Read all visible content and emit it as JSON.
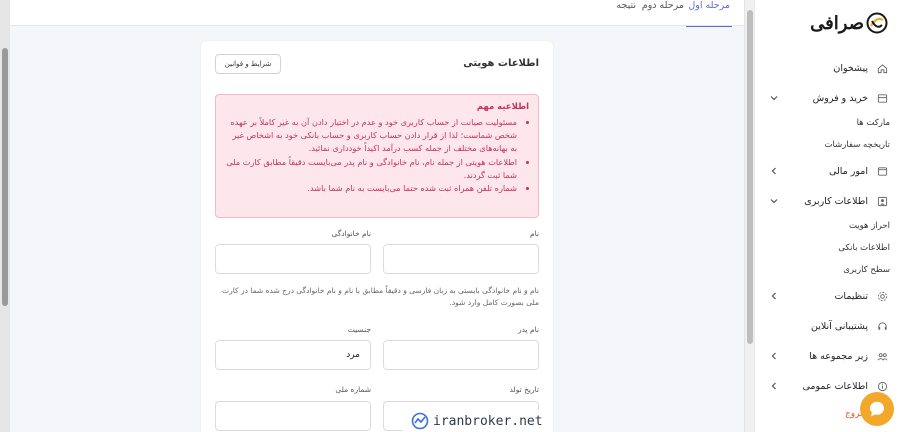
{
  "tabs": [
    "مرحله اول",
    "مرحله دوم",
    "نتیجه"
  ],
  "card": {
    "title": "اطلاعات هویتی",
    "terms_button": "شرایط و قوانین"
  },
  "alert": {
    "title": "اطلاعیه مهم",
    "items": [
      "مسئولیت صیانت از حساب کاربری خود و عدم در اختیار دادن آن به غیر کاملاً بر عهده شخص شماست؛ لذا از قرار دادن حساب کاربری و حساب بانکی خود به اشخاص غیر به بهانه‌های مختلف از جمله کسب درآمد اکیداً خودداری نمائید.",
      "اطلاعات هویتی از جمله نام، نام خانوادگی و نام پدر می‌بایست دقیقاً مطابق کارت ملی شما ثبت گردند.",
      "شماره تلفن همراه ثبت شده حتما می‌بایست به نام شما باشد."
    ]
  },
  "fields": {
    "first_name_label": "نام",
    "last_name_label": "نام خانوادگی",
    "name_note": "نام و نام خانوادگی بایستی به زبان فارسی و دقیقاً مطابق با نام و نام خانوادگی درج شده شما در کارت ملی بصورت کامل وارد شود.",
    "father_name_label": "نام پدر",
    "gender_label": "جنسیت",
    "gender_value": "مرد",
    "birth_date_label": "تاریخ تولد",
    "national_id_label": "شماره ملی"
  },
  "watermark": "iranbroker.net",
  "sidebar": {
    "logo": "صرافی",
    "items": [
      {
        "label": "پیشخوان",
        "icon": "home-icon"
      },
      {
        "label": "خرید و فروش",
        "icon": "exchange-icon"
      },
      {
        "label": "امور مالی",
        "icon": "wallet-icon"
      },
      {
        "label": "اطلاعات کاربری",
        "icon": "user-icon"
      },
      {
        "label": "تنظیمات",
        "icon": "gear-icon"
      },
      {
        "label": "پشتیبانی آنلاین",
        "icon": "headset-icon"
      },
      {
        "label": "زیر مجموعه ها",
        "icon": "users-icon"
      },
      {
        "label": "اطلاعات عمومی",
        "icon": "info-icon"
      }
    ],
    "sub_trade": [
      "مارکت ها",
      "تاریخچه سفارشات"
    ],
    "sub_user": [
      "احراز هویت",
      "اطلاعات بانکی",
      "سطح کاربری"
    ],
    "cut_item": "خروج"
  },
  "colors": {
    "accent": "#5a6fd6",
    "alert_bg": "#fde6ec",
    "alert_text": "#c43357",
    "chat": "#f2a82a"
  }
}
